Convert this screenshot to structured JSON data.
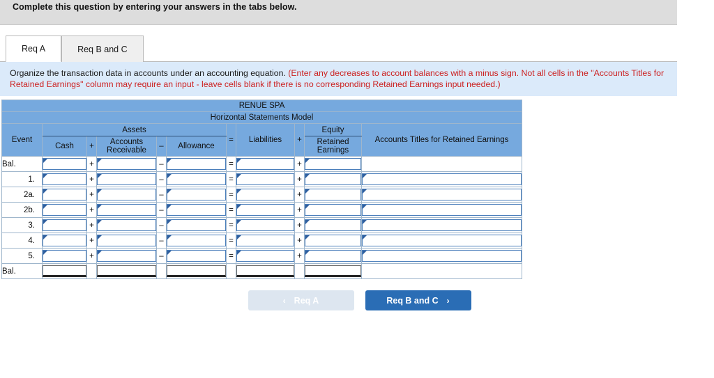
{
  "topbar": {
    "text": "Complete this question by entering your answers in the tabs below."
  },
  "tabs": [
    {
      "label": "Req A",
      "active": true
    },
    {
      "label": "Req B and C",
      "active": false
    }
  ],
  "requirement": {
    "main": "Organize the transaction data in accounts under an accounting equation.",
    "hint": "(Enter any decreases to account balances with a minus sign. Not all cells in the \"Accounts Titles for Retained Earnings\" column may require an input - leave cells blank if there is no corresponding Retained Earnings input needed.)"
  },
  "table": {
    "company_title": "RENUE SPA",
    "model_title": "Horizontal Statements Model",
    "group_assets": "Assets",
    "group_equity": "Equity",
    "col_event": "Event",
    "col_cash": "Cash",
    "col_accounts_receivable": "Accounts Receivable",
    "col_allowance": "Allowance",
    "col_liabilities": "Liabilities",
    "col_retained_earnings": "Retained Earnings",
    "col_accounts_titles": "Accounts Titles for Retained Earnings",
    "op_plus": "+",
    "op_minus": "–",
    "op_equals": "=",
    "rows": [
      {
        "event": "Bal.",
        "align": "left",
        "cash": "",
        "ar": "",
        "allowance": "",
        "liabilities": "",
        "re": "",
        "titles": null
      },
      {
        "event": "1.",
        "align": "right",
        "cash": "",
        "ar": "",
        "allowance": "",
        "liabilities": "",
        "re": "",
        "titles": ""
      },
      {
        "event": "2a.",
        "align": "right",
        "cash": "",
        "ar": "",
        "allowance": "",
        "liabilities": "",
        "re": "",
        "titles": ""
      },
      {
        "event": "2b.",
        "align": "right",
        "cash": "",
        "ar": "",
        "allowance": "",
        "liabilities": "",
        "re": "",
        "titles": ""
      },
      {
        "event": "3.",
        "align": "right",
        "cash": "",
        "ar": "",
        "allowance": "",
        "liabilities": "",
        "re": "",
        "titles": ""
      },
      {
        "event": "4.",
        "align": "right",
        "cash": "",
        "ar": "",
        "allowance": "",
        "liabilities": "",
        "re": "",
        "titles": ""
      },
      {
        "event": "5.",
        "align": "right",
        "cash": "",
        "ar": "",
        "allowance": "",
        "liabilities": "",
        "re": "",
        "titles": ""
      }
    ],
    "total_row": {
      "event": "Bal.",
      "cash": "",
      "ar": "",
      "allowance": "",
      "liabilities": "",
      "re": ""
    }
  },
  "nav": {
    "prev_label": "Req A",
    "next_label": "Req B and C",
    "prev_chevron": "‹",
    "next_chevron": "›"
  },
  "colors": {
    "header_blue": "#76a9de",
    "band_blue": "#dbeafa",
    "hint_red": "#cc2222",
    "next_button": "#2a6db5",
    "prev_button": "#dde6f0",
    "input_border": "#4a7ebb"
  }
}
